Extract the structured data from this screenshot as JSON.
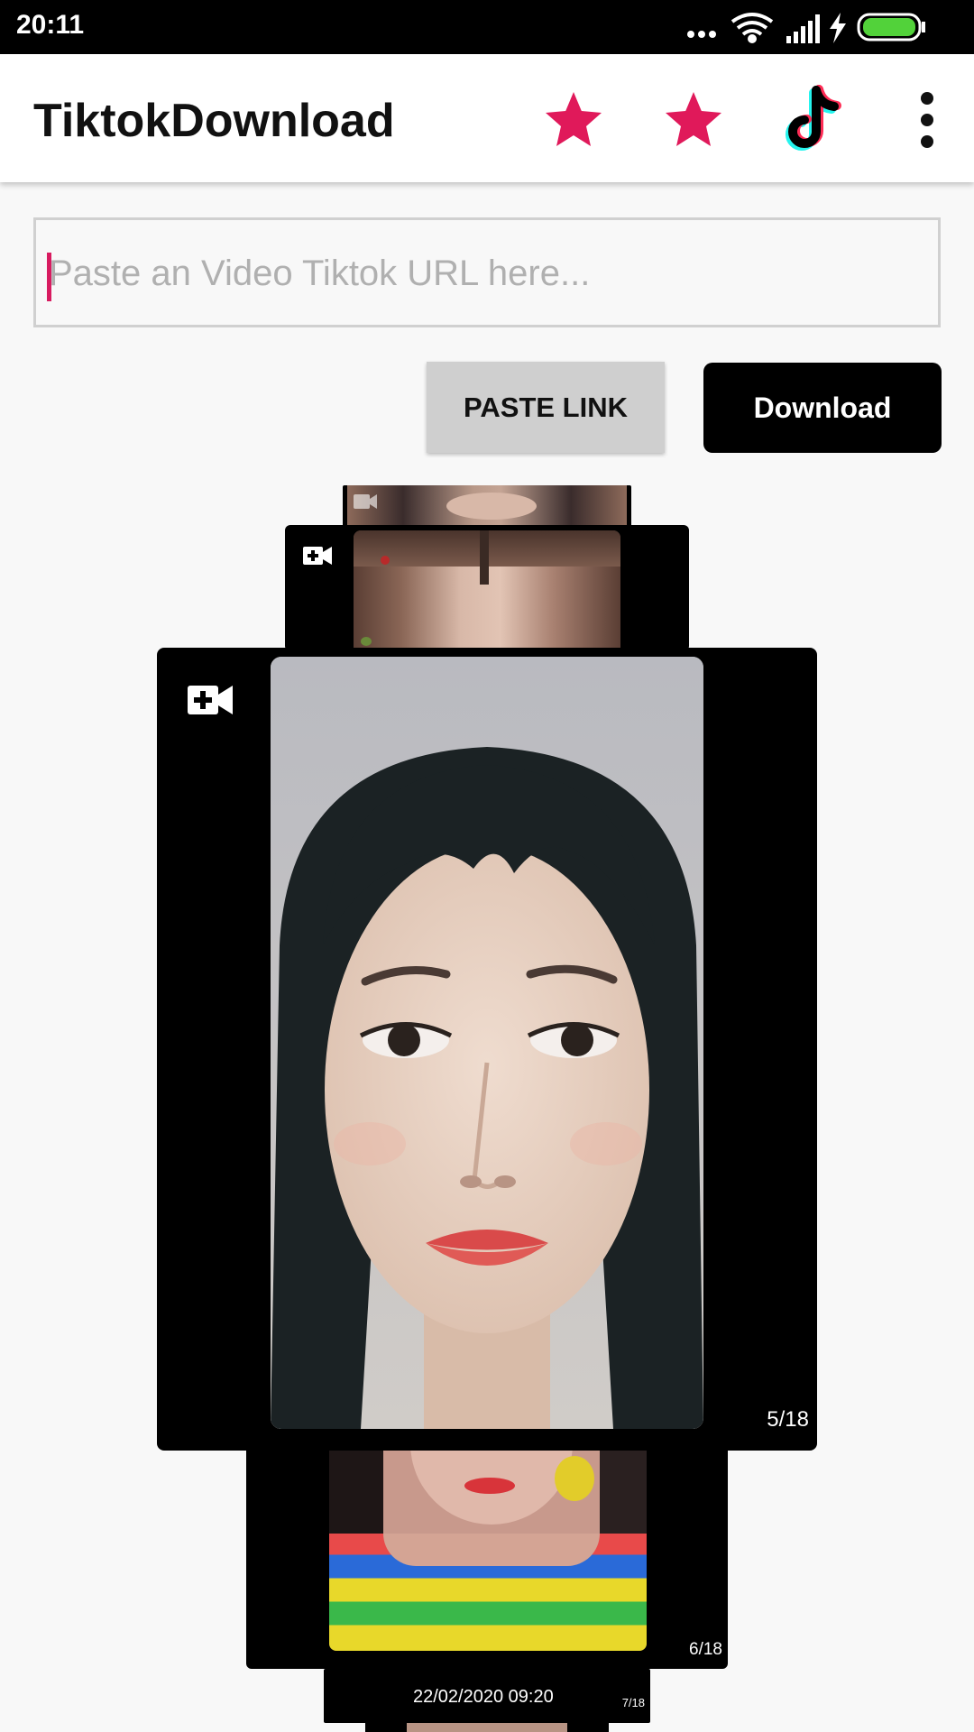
{
  "status_bar": {
    "time": "20:11",
    "icons": [
      "more-dots-icon",
      "wifi-icon",
      "signal-icon",
      "charging-icon",
      "battery-icon"
    ],
    "battery_color": "#52d23a"
  },
  "app_bar": {
    "title": "TiktokDownload",
    "actions": [
      "star-icon",
      "star-icon",
      "tiktok-icon",
      "more-vert-icon"
    ],
    "accent": "#e0195a"
  },
  "url_input": {
    "placeholder": "Paste an Video Tiktok URL here...",
    "value": ""
  },
  "buttons": {
    "paste_label": "PASTE LINK",
    "download_label": "Download"
  },
  "cards": [
    {
      "icon": "video-camera-add-icon"
    },
    {
      "icon": "video-camera-add-icon"
    },
    {
      "icon": "video-camera-add-icon",
      "counter": "5/18"
    },
    {
      "counter": "6/18"
    },
    {
      "date": "22/02/2020 09:20",
      "counter": "7/18"
    }
  ]
}
